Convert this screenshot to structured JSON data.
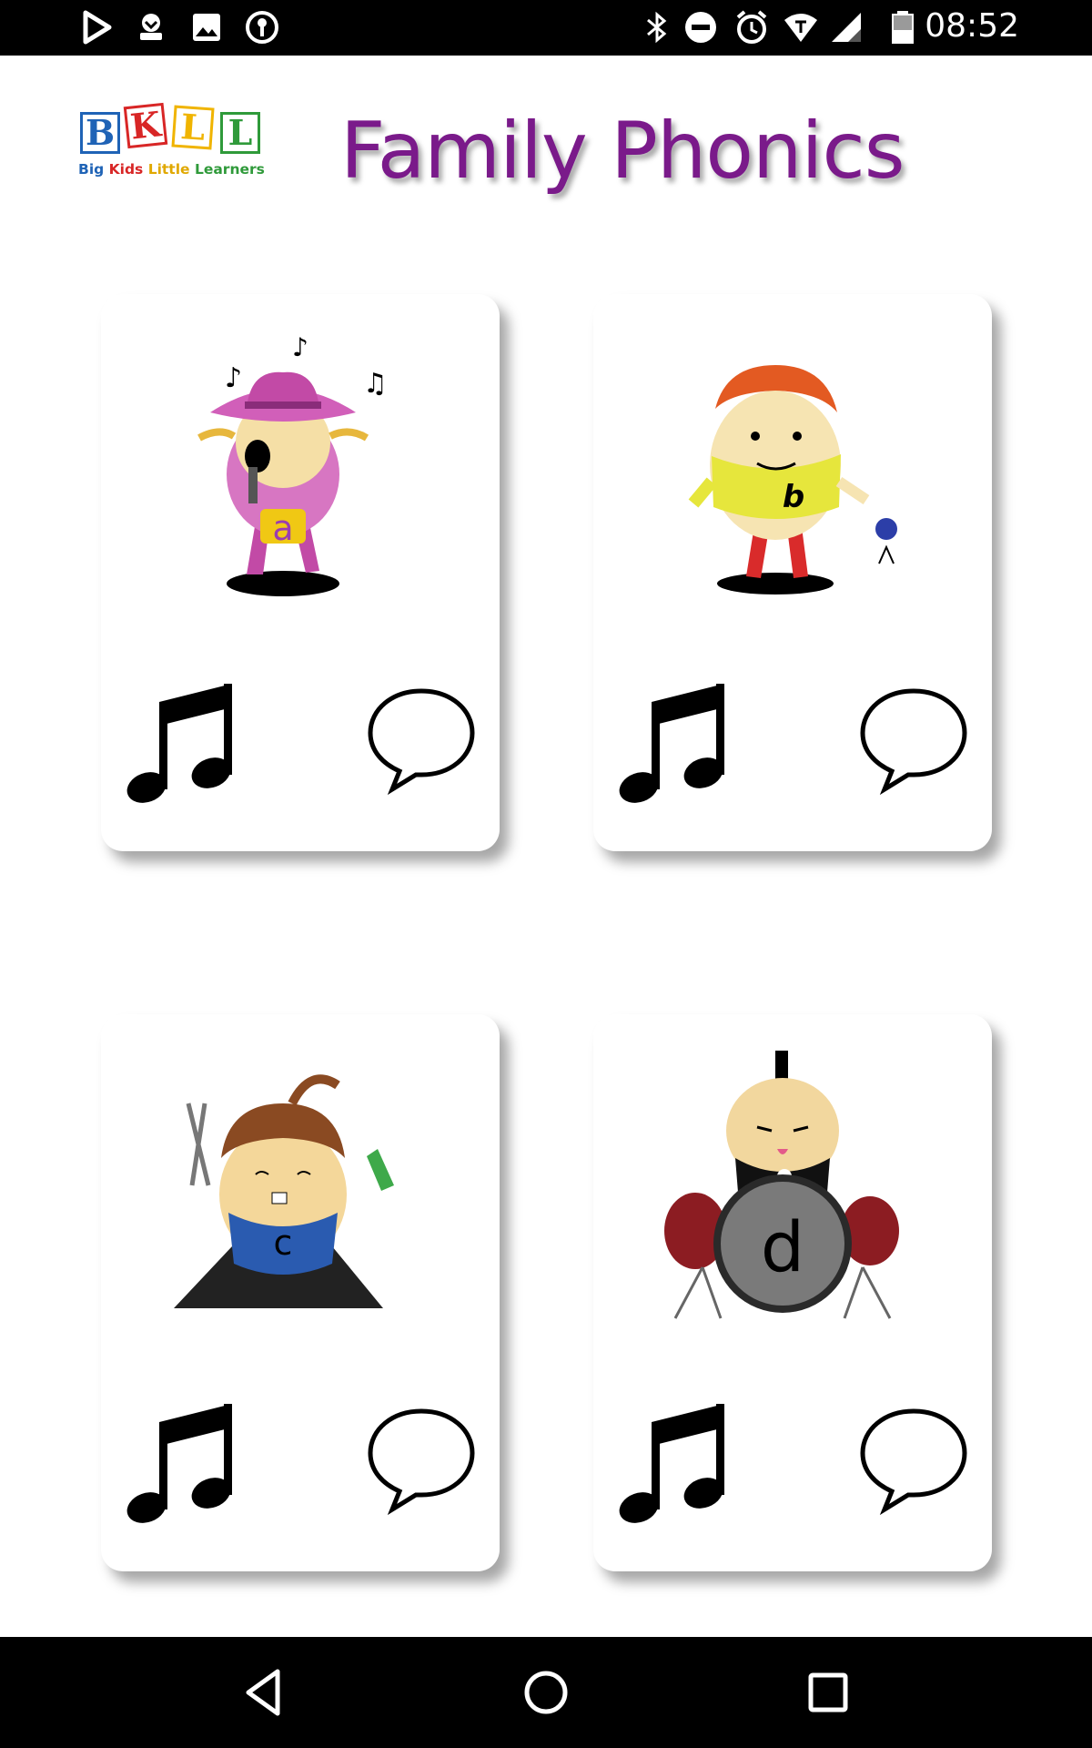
{
  "status_bar": {
    "time": "08:52",
    "left_icons": [
      "play-store-icon",
      "download-icon",
      "image-icon",
      "vpn-key-icon"
    ],
    "right_icons": [
      "bluetooth-icon",
      "do-not-disturb-icon",
      "alarm-icon",
      "wifi-icon",
      "signal-icon",
      "battery-icon"
    ]
  },
  "header": {
    "logo_letters": [
      "B",
      "K",
      "L",
      "L"
    ],
    "logo_tagline_words": [
      "Big",
      "Kids",
      "Little",
      "Learners"
    ],
    "title": "Family Phonics"
  },
  "colors": {
    "title": "#7a1a8a",
    "logo_b": "#1f63b6",
    "logo_k": "#d82626",
    "logo_l1": "#f0b400",
    "logo_l2": "#2f9a3a"
  },
  "cards": [
    {
      "letter": "a",
      "character": "singing cowgirl",
      "music_icon": "music-note-icon",
      "speech_icon": "speech-bubble-icon"
    },
    {
      "letter": "b",
      "character": "boy bouncing ball",
      "music_icon": "music-note-icon",
      "speech_icon": "speech-bubble-icon"
    },
    {
      "letter": "c",
      "character": "girl cutting paper",
      "music_icon": "music-note-icon",
      "speech_icon": "speech-bubble-icon"
    },
    {
      "letter": "d",
      "character": "drummer",
      "music_icon": "music-note-icon",
      "speech_icon": "speech-bubble-icon"
    }
  ],
  "nav_bar": {
    "buttons": [
      "back-icon",
      "home-icon",
      "recents-icon"
    ]
  }
}
